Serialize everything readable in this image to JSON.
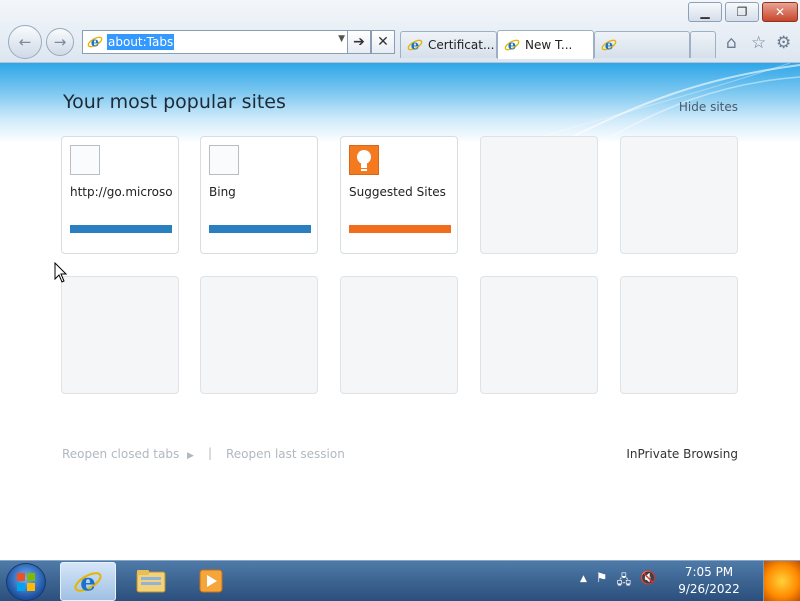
{
  "window": {
    "minimize_icon": "minimize-icon",
    "restore_icon": "restore-icon",
    "close_icon": "close-icon"
  },
  "address_bar": {
    "url": "about:Tabs"
  },
  "tabs": [
    {
      "label": "Certificat...",
      "active": false
    },
    {
      "label": "New T...",
      "active": true
    },
    {
      "label": "",
      "active": false
    }
  ],
  "page": {
    "heading": "Your most popular sites",
    "hide_sites": "Hide sites",
    "sites": [
      {
        "name": "http://go.microso",
        "bar_color": "#2a7fc0"
      },
      {
        "name": "Bing",
        "bar_color": "#2a7fc0"
      },
      {
        "name": "Suggested Sites",
        "bar_color": "#f36b1c"
      }
    ],
    "reopen_closed_tabs": "Reopen closed tabs",
    "separator": "|",
    "reopen_last_session": "Reopen last session",
    "inprivate": "InPrivate Browsing"
  },
  "taskbar": {
    "time": "7:05 PM",
    "date": "9/26/2022"
  },
  "colors": {
    "accent_blue": "#2ea6e8",
    "tile_bar_blue": "#2a7fc0",
    "tile_bar_orange": "#f36b1c"
  }
}
